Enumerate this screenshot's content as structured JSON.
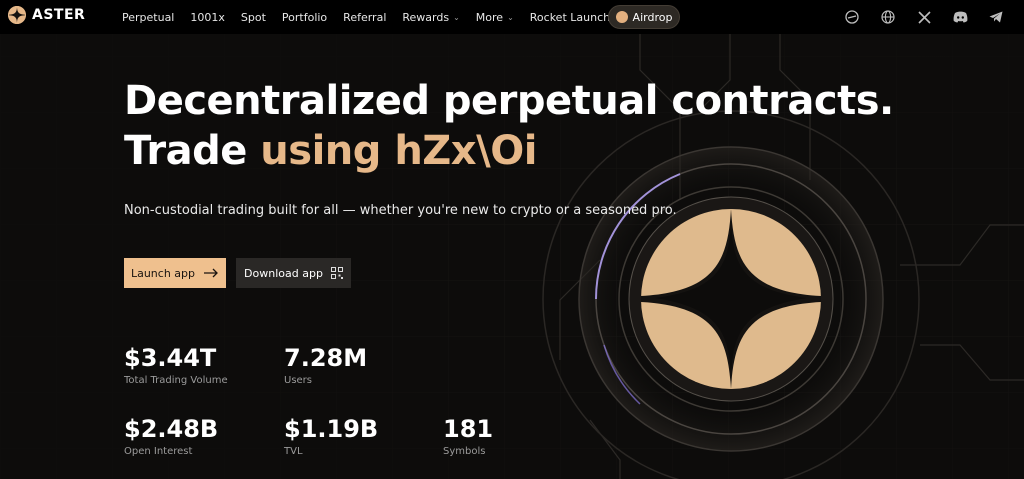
{
  "brand": {
    "name": "ASTER"
  },
  "nav": {
    "links": [
      {
        "label": "Perpetual"
      },
      {
        "label": "1001x"
      },
      {
        "label": "Spot"
      },
      {
        "label": "Portfolio"
      },
      {
        "label": "Referral"
      },
      {
        "label": "Rewards"
      },
      {
        "label": "More"
      },
      {
        "label": "Rocket Launch"
      }
    ],
    "airdrop_label": "Airdrop",
    "icons": [
      "docs-icon",
      "globe-icon",
      "x-icon",
      "discord-icon",
      "telegram-icon"
    ]
  },
  "hero": {
    "headline_line1": "Decentralized perpetual contracts.",
    "headline_line2_prefix": "Trade ",
    "headline_line2_accent": "using hZx\\Oi",
    "subtitle": "Non-custodial trading built for all — whether you're new to crypto or a seasoned pro.",
    "launch_label": "Launch app",
    "download_label": "Download app"
  },
  "stats": [
    {
      "value": "$3.44T",
      "label": "Total Trading Volume"
    },
    {
      "value": "7.28M",
      "label": "Users"
    },
    {
      "value": "$2.48B",
      "label": "Open Interest"
    },
    {
      "value": "$1.19B",
      "label": "TVL"
    },
    {
      "value": "181",
      "label": "Symbols"
    }
  ],
  "colors": {
    "accent": "#e6b889",
    "background": "#0d0c0b",
    "nav_background": "#000000",
    "launch_button": "#efc08e"
  }
}
